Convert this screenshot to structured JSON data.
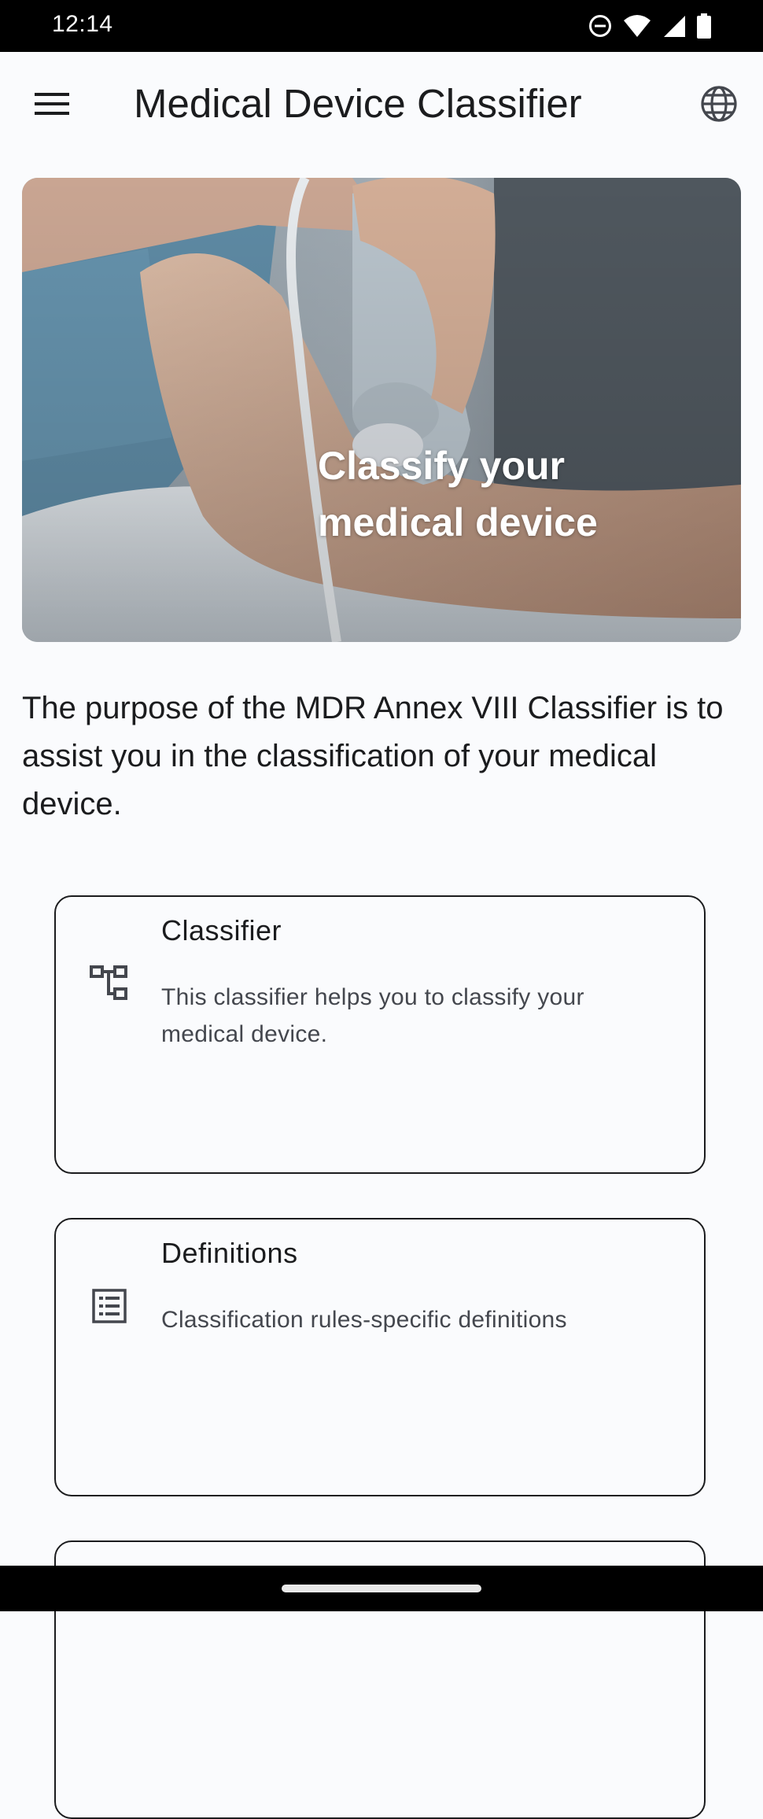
{
  "status_bar": {
    "time": "12:14",
    "icons": [
      "do-not-disturb-icon",
      "wifi-icon",
      "signal-icon",
      "battery-icon"
    ]
  },
  "app_bar": {
    "title": "Medical Device Classifier",
    "menu_icon": "menu-icon",
    "language_icon": "globe-icon"
  },
  "hero": {
    "title_line1": "Classify your",
    "title_line2": "medical device"
  },
  "intro": {
    "text": "The purpose of the MDR Annex VIII Classifier is to assist you in the classification of your medical device."
  },
  "cards": [
    {
      "title": "Classifier",
      "description": "This classifier helps you to classify your medical device.",
      "icon": "account-tree-icon"
    },
    {
      "title": "Definitions",
      "description": "Classification rules-specific definitions",
      "icon": "list-icon"
    }
  ],
  "colors": {
    "background": "#fafbfd",
    "text_primary": "#1b1c1e",
    "text_secondary": "#44474e",
    "card_border": "#1b1c1e",
    "hero_text": "#ffffff"
  }
}
